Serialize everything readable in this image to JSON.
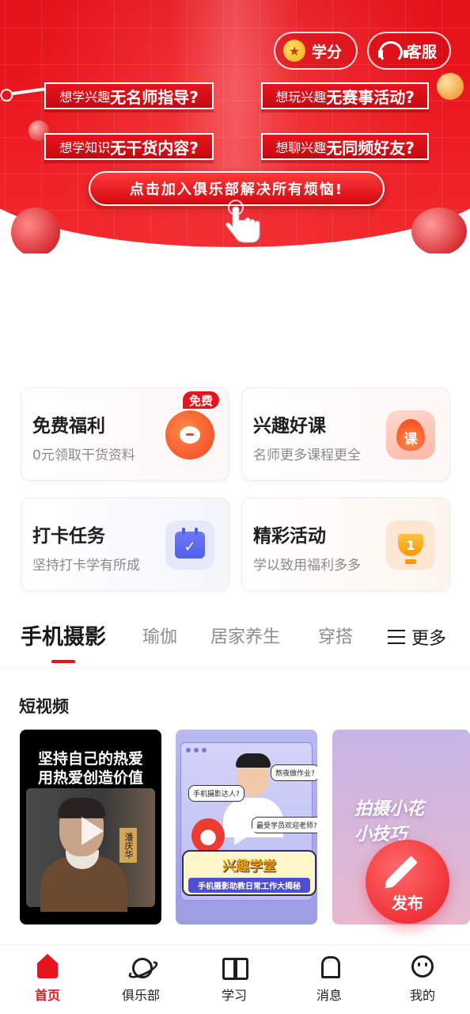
{
  "header": {
    "points_label": "学分",
    "service_label": "客服",
    "questions": [
      {
        "prefix": "想学兴趣",
        "emphasis": "无名师指导?"
      },
      {
        "prefix": "想玩兴趣",
        "emphasis": "无赛事活动?"
      },
      {
        "prefix": "想学知识",
        "emphasis": "无干货内容?"
      },
      {
        "prefix": "想聊兴趣",
        "emphasis": "无同频好友?"
      }
    ],
    "cta_label": "点击加入俱乐部解决所有烦恼!"
  },
  "features": [
    {
      "title": "免费福利",
      "subtitle": "0元领取干货资料",
      "badge": "免费",
      "icon": "chat-bubble-icon"
    },
    {
      "title": "兴趣好课",
      "subtitle": "名师更多课程更全",
      "icon_text": "课",
      "icon": "flame-course-icon"
    },
    {
      "title": "打卡任务",
      "subtitle": "坚持打卡学有所成",
      "icon": "calendar-check-icon"
    },
    {
      "title": "精彩活动",
      "subtitle": "学以致用福利多多",
      "icon_text": "1",
      "icon": "trophy-icon"
    }
  ],
  "tabs": {
    "items": [
      "手机摄影",
      "瑜伽",
      "居家养生",
      "穿搭"
    ],
    "active_index": 0,
    "more_label": "更多"
  },
  "videos_section": {
    "title": "短视频",
    "videos": [
      {
        "line1": "坚持自己的热爱",
        "line2": "用热爱创造价值",
        "name_tag": "潘庆华"
      },
      {
        "bubble1": "熬夜做作业?",
        "bubble2": "手机摄影达人?",
        "bubble3": "最受学员欢迎老师?",
        "banner_title": "兴趣学堂",
        "banner_sub": "手机摄影助教日常工作大揭秘"
      },
      {
        "line1": "拍摄小花",
        "line2": "小技巧"
      }
    ]
  },
  "fab": {
    "label": "发布"
  },
  "bottom_nav": {
    "items": [
      {
        "label": "首页",
        "icon": "home-icon"
      },
      {
        "label": "俱乐部",
        "icon": "planet-icon"
      },
      {
        "label": "学习",
        "icon": "book-icon"
      },
      {
        "label": "消息",
        "icon": "bell-icon"
      },
      {
        "label": "我的",
        "icon": "face-icon"
      }
    ],
    "active_index": 0
  },
  "colors": {
    "brand_red": "#e8141c",
    "muted_text": "#8a8a8a"
  }
}
